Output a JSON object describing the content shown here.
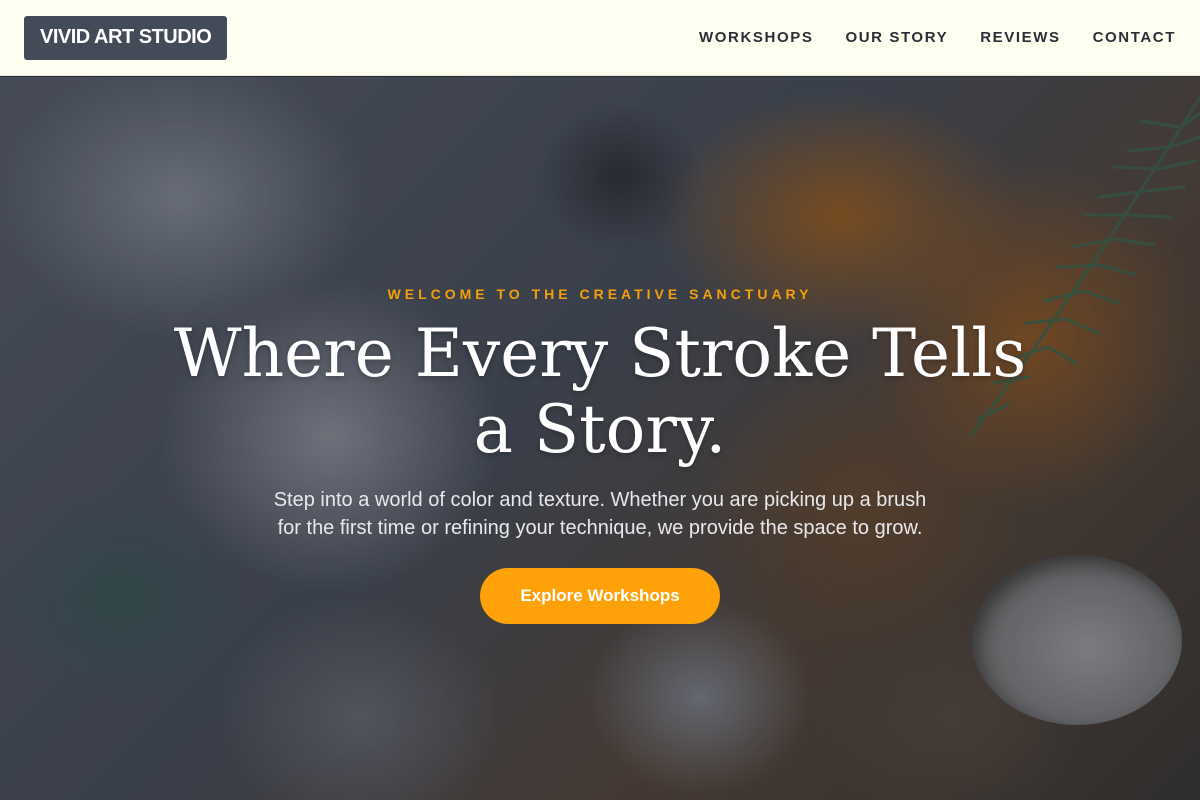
{
  "header": {
    "logo": "VIVID ART STUDIO",
    "nav": [
      {
        "label": "WORKSHOPS"
      },
      {
        "label": "OUR STORY"
      },
      {
        "label": "REVIEWS"
      },
      {
        "label": "CONTACT"
      }
    ]
  },
  "hero": {
    "eyebrow": "WELCOME TO THE CREATIVE SANCTUARY",
    "headline": "Where Every Stroke Tells a Story.",
    "subtext": "Step into a world of color and texture. Whether you are picking up a brush for the first time or refining your technique, we provide the space to grow.",
    "cta_label": "Explore Workshops",
    "background": "textured-paint-palette-image"
  },
  "colors": {
    "accent": "#ffa20a",
    "eyebrow": "#f2a00b",
    "header_bg": "#fffff0",
    "logo_bg": "#444b58",
    "nav_text": "#2a2e38"
  }
}
